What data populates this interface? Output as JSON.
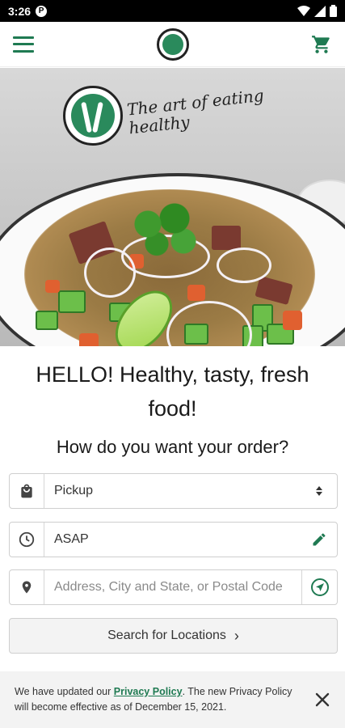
{
  "status_bar": {
    "time": "3:26",
    "notification_glyph": "P"
  },
  "header": {
    "menu_icon": "hamburger-menu-icon",
    "logo": "pita-jungle-logo",
    "cart_icon": "shopping-cart-icon",
    "accent_color": "#1f7a52"
  },
  "hero": {
    "tagline": "The art of eating healthy"
  },
  "main": {
    "headline": "HELLO! Healthy, tasty, fresh food!",
    "question": "How do you want your order?"
  },
  "form": {
    "order_type": {
      "icon": "shopping-bag-icon",
      "selected": "Pickup",
      "right_icon": "dropdown-arrows-icon"
    },
    "time": {
      "icon": "clock-icon",
      "value": "ASAP",
      "right_icon": "pencil-edit-icon"
    },
    "address": {
      "icon": "location-pin-icon",
      "placeholder": "Address, City and State, or Postal Code",
      "right_icon": "navigation-arrow-icon"
    },
    "search_button": {
      "label": "Search for Locations",
      "chevron": "›"
    }
  },
  "privacy_banner": {
    "prefix": "We have updated our ",
    "link_text": "Privacy Policy",
    "suffix": ". The new Privacy Policy will become effective as of December 15, 2021.",
    "close_icon": "close-icon"
  }
}
